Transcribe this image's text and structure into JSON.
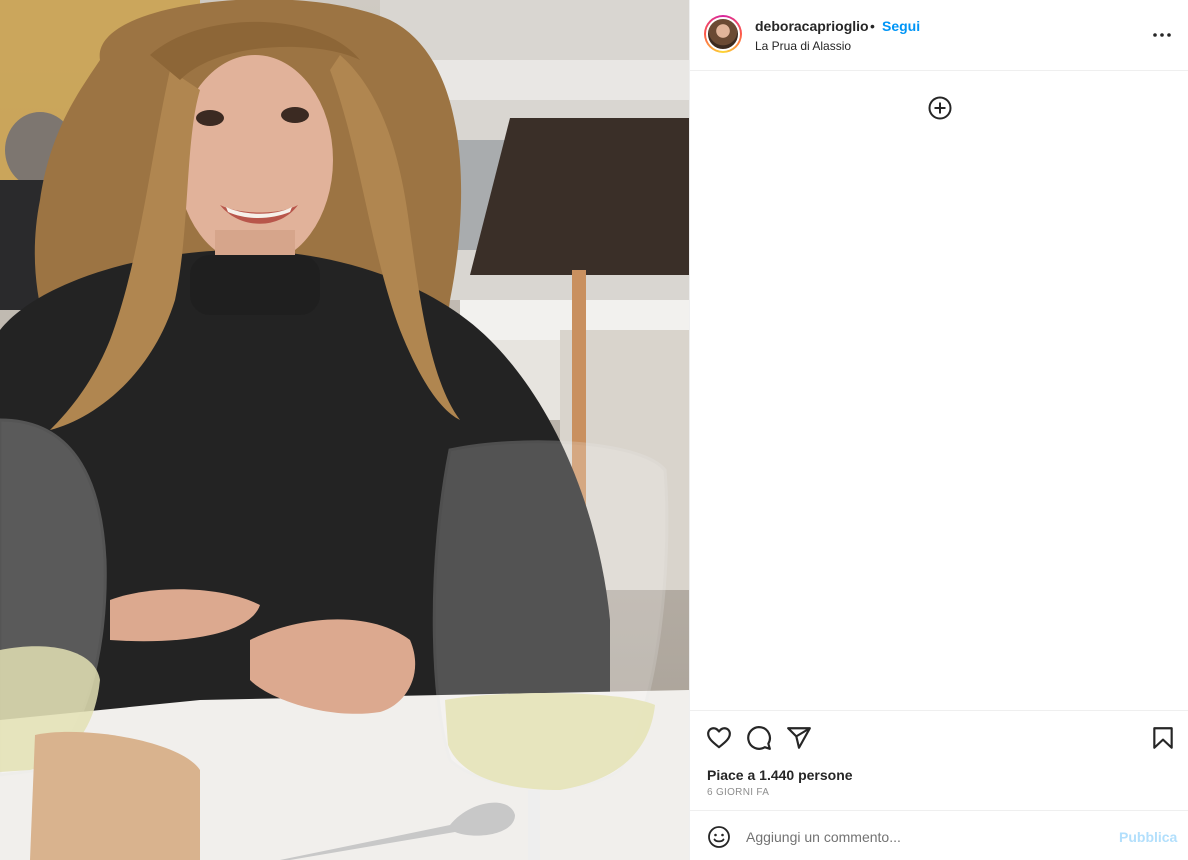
{
  "post": {
    "username": "deboracaprioglio",
    "separator": "•",
    "follow_label": "Segui",
    "location": "La Prua di Alassio",
    "likes_text": "Piace a 1.440 persone",
    "time_ago": "6 GIORNI FA"
  },
  "comment_box": {
    "placeholder": "Aggiungi un commento...",
    "publish_label": "Pubblica"
  },
  "icons": {
    "more": "more-options-icon",
    "add_comment": "add-circle-icon",
    "like": "heart-icon",
    "comment": "comment-icon",
    "share": "share-icon",
    "save": "bookmark-icon",
    "emoji": "emoji-icon"
  },
  "colors": {
    "accent": "#0095f6",
    "publish_disabled": "#b2dffc",
    "muted_text": "#8e8e8e"
  }
}
